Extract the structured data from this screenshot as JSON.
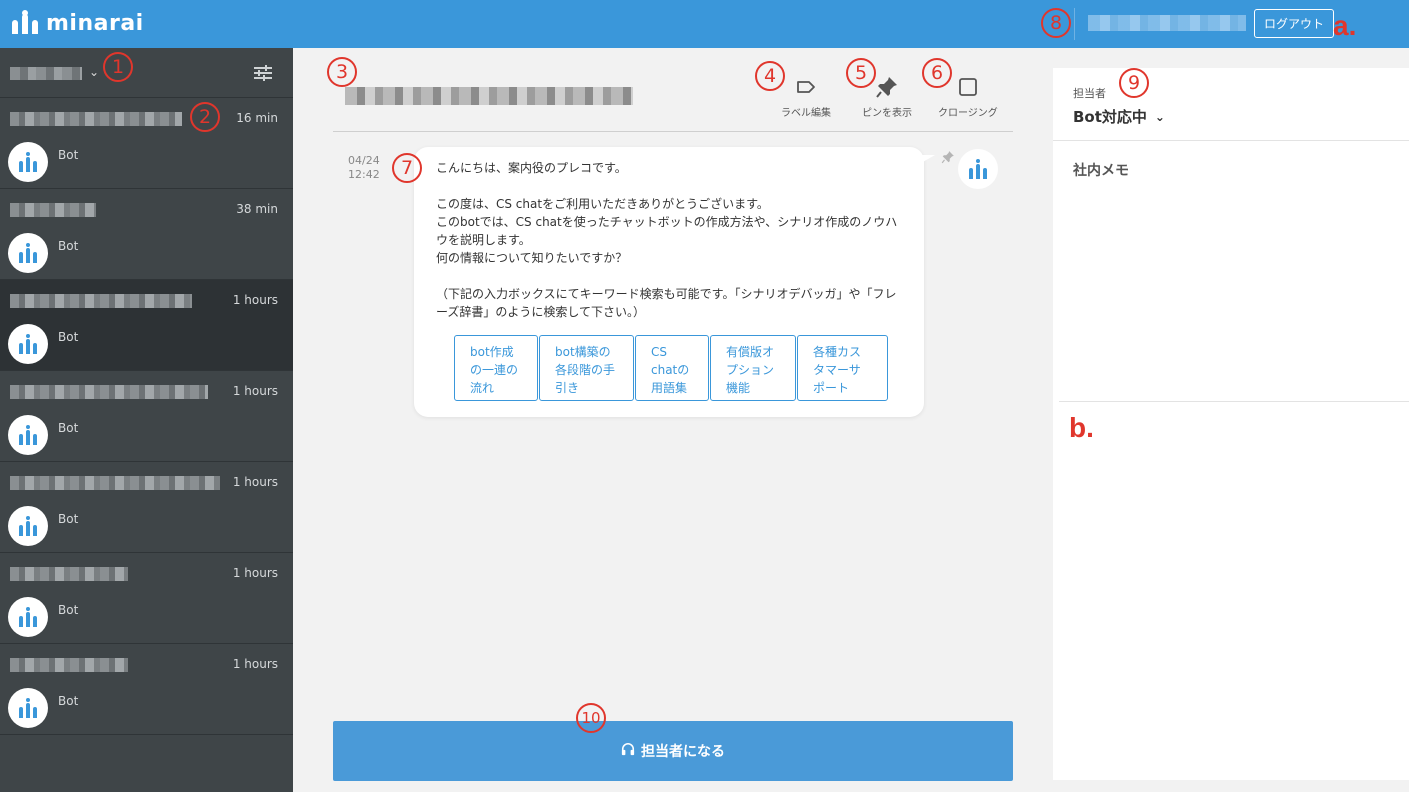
{
  "header": {
    "logo_text": "minarai",
    "logout_label": "ログアウト"
  },
  "sidebar": {
    "chats": [
      {
        "time": "16 min",
        "preview": "Bot",
        "active": false
      },
      {
        "time": "38 min",
        "preview": "Bot",
        "active": false
      },
      {
        "time": "1 hours",
        "preview": "Bot",
        "active": true
      },
      {
        "time": "1 hours",
        "preview": "Bot",
        "active": false
      },
      {
        "time": "1 hours",
        "preview": "Bot",
        "active": false
      },
      {
        "time": "1 hours",
        "preview": "Bot",
        "active": false
      },
      {
        "time": "1 hours",
        "preview": "Bot",
        "active": false
      }
    ]
  },
  "toolbar": {
    "label_edit": "ラベル編集",
    "show_pins": "ピンを表示",
    "closing": "クロージング"
  },
  "message": {
    "date": "04/24",
    "time": "12:42",
    "text": "こんにちは、案内役のプレコです。\n\nこの度は、CS chatをご利用いただきありがとうございます。\nこのbotでは、CS chatを使ったチャットボットの作成方法や、シナリオ作成のノウハ\nウを説明します。\n何の情報について知りたいですか？\n\n（下記の入力ボックスにてキーワード検索も可能です。「シナリオデバッガ」や「フレ\nーズ辞書」のように検索して下さい。）",
    "quick_replies": [
      "bot作成\nの一連の\n流れ",
      "bot構築の\n各段階の手\n引き",
      "CS\nchatの\n用語集",
      "有償版オ\nプション\n機能",
      "各種カス\nタマーサ\nポート"
    ]
  },
  "assign_button": "担当者になる",
  "right_panel": {
    "assignee_label": "担当者",
    "assignee_value": "Bot対応中",
    "memo_label": "社内メモ"
  },
  "annotations": {
    "n1": "1",
    "n2": "2",
    "n3": "3",
    "n4": "4",
    "n5": "5",
    "n6": "6",
    "n7": "7",
    "n8": "8",
    "n9": "9",
    "n10": "10",
    "a": "a.",
    "b": "b."
  },
  "colors": {
    "brand_blue": "#3a97da",
    "sidebar_bg": "#3f4548",
    "annotation_red": "#e0362c"
  }
}
